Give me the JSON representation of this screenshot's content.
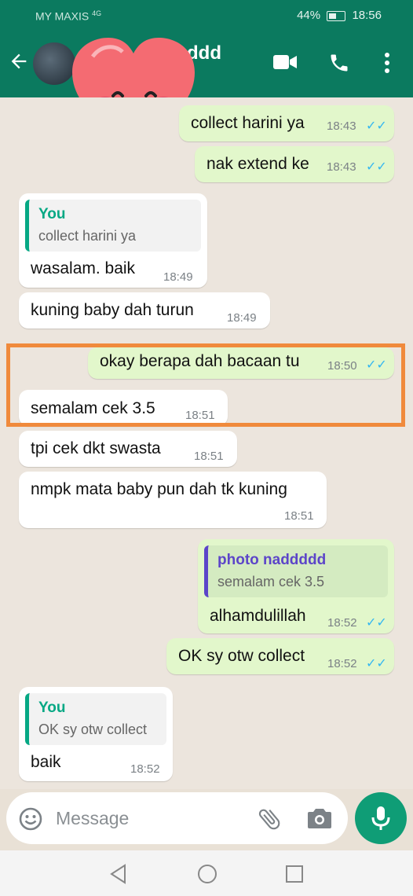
{
  "status_bar": {
    "carrier": "MY MAXIS",
    "network": "4G",
    "battery": "44%",
    "clock": "18:56"
  },
  "header": {
    "contact_name_partial": "ddd"
  },
  "messages": [
    {
      "dir": "out",
      "text": "collect harini ya",
      "time": "18:43",
      "ticks": "✓✓"
    },
    {
      "dir": "out",
      "text": "nak extend ke",
      "time": "18:43",
      "ticks": "✓✓"
    },
    {
      "dir": "in",
      "quote_name": "You",
      "quote_text": "collect harini ya",
      "text": "wasalam. baik",
      "time": "18:49"
    },
    {
      "dir": "in",
      "text": "kuning baby dah turun",
      "time": "18:49"
    },
    {
      "dir": "out",
      "text": "okay berapa dah bacaan tu",
      "time": "18:50",
      "ticks": "✓✓"
    },
    {
      "dir": "in",
      "text": "semalam cek 3.5",
      "time": "18:51"
    },
    {
      "dir": "in",
      "text": "tpi cek dkt swasta",
      "time": "18:51"
    },
    {
      "dir": "in",
      "text": "nmpk mata baby pun dah tk kuning",
      "time": "18:51"
    },
    {
      "dir": "out",
      "quote_name": "photo naddddd",
      "quote_text": "semalam cek 3.5",
      "text": "alhamdulillah",
      "time": "18:52",
      "ticks": "✓✓"
    },
    {
      "dir": "out",
      "text": "OK sy otw collect",
      "time": "18:52",
      "ticks": "✓✓"
    },
    {
      "dir": "in",
      "quote_name": "You",
      "quote_text": "OK sy otw collect",
      "text": "baik",
      "time": "18:52"
    }
  ],
  "composer": {
    "placeholder": "Message"
  },
  "colors": {
    "header": "#0b7a5f",
    "outgoing": "#e2f7cb",
    "incoming": "#ffffff",
    "highlight": "#f08a3c",
    "mic": "#0f9d76"
  },
  "icons": [
    "back-arrow-icon",
    "video-call-icon",
    "phone-icon",
    "more-icon",
    "emoji-icon",
    "attach-icon",
    "camera-icon",
    "mic-icon",
    "nav-back-icon",
    "nav-home-icon",
    "nav-recents-icon"
  ]
}
